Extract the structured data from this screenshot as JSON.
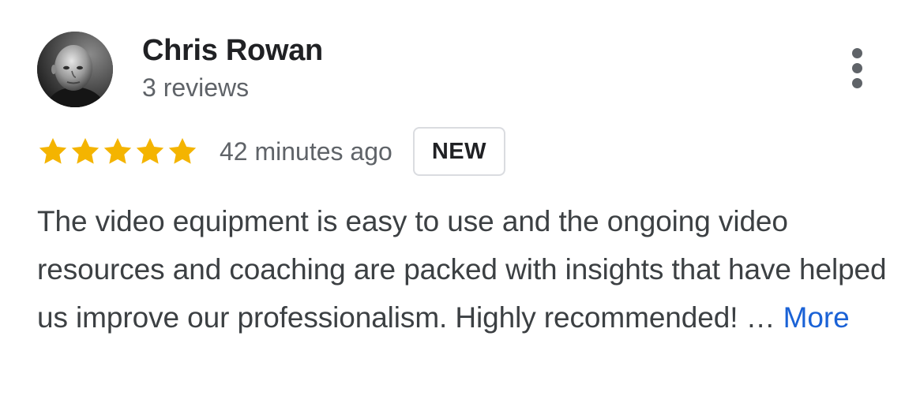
{
  "review": {
    "author_name": "Chris Rowan",
    "review_count": "3 reviews",
    "rating": 5,
    "max_rating": 5,
    "timestamp": "42 minutes ago",
    "badge": "NEW",
    "text": "The video equipment is easy to use and the ongoing video resources and coaching are packed with insights that have helped us improve our professionalism. Highly recommended!",
    "ellipsis": "…",
    "more_label": "More"
  },
  "icons": {
    "avatar": "profile-photo",
    "star": "star-icon",
    "menu": "more-vert-icon"
  },
  "colors": {
    "star": "#F4B400",
    "link": "#1A62D6",
    "secondary_text": "#5F6368",
    "badge_border": "#DADCE0"
  }
}
